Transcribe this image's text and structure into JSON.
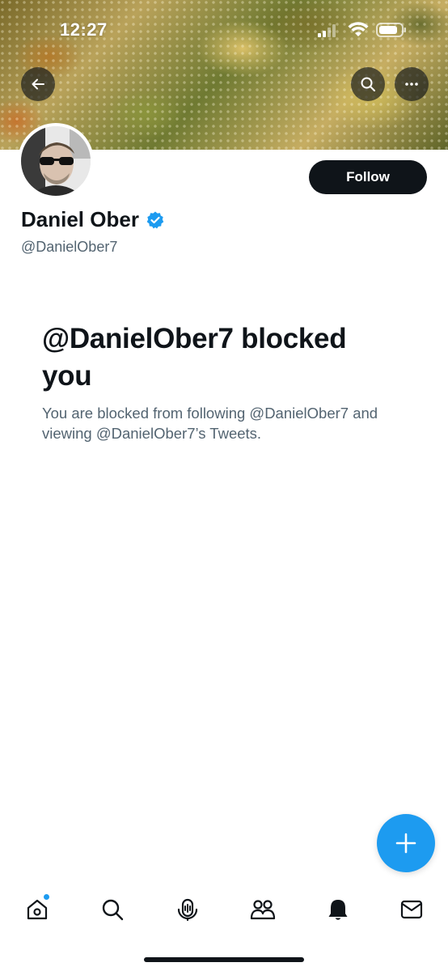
{
  "status_bar": {
    "time": "12:27"
  },
  "profile": {
    "display_name": "Daniel Ober",
    "handle": "@DanielOber7",
    "verified": true,
    "follow_label": "Follow"
  },
  "blocked": {
    "title": "@DanielOber7 blocked you",
    "description": "You are blocked from following @DanielOber7 and viewing @DanielOber7’s Tweets."
  },
  "icons": {
    "back": "arrow-left-icon",
    "search": "search-icon",
    "more": "more-horizontal-icon",
    "verified": "verified-badge-icon",
    "compose": "plus-icon",
    "nav": [
      "home-icon",
      "search-icon",
      "spaces-icon",
      "communities-icon",
      "notifications-icon",
      "messages-icon"
    ]
  },
  "colors": {
    "accent": "#1d9bf0",
    "text_primary": "#0f1419",
    "text_secondary": "#536471",
    "button_dark": "#0f1419"
  }
}
